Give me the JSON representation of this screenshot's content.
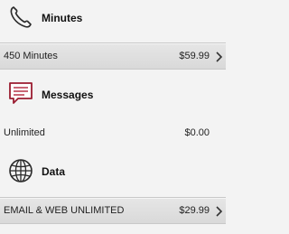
{
  "sections": [
    {
      "title": "Minutes",
      "icon": "phone-icon",
      "item": {
        "label": "450 Minutes",
        "price": "$59.99",
        "selected": true,
        "chevron": true
      }
    },
    {
      "title": "Messages",
      "icon": "message-icon",
      "item": {
        "label": "Unlimited",
        "price": "$0.00",
        "selected": false,
        "chevron": false
      }
    },
    {
      "title": "Data",
      "icon": "globe-icon",
      "item": {
        "label": "EMAIL & WEB UNLIMITED",
        "price": "$29.99",
        "selected": true,
        "chevron": true
      }
    }
  ],
  "colors": {
    "message_icon_accent": "#b0243a",
    "icon_dark": "#2a2a2a"
  }
}
